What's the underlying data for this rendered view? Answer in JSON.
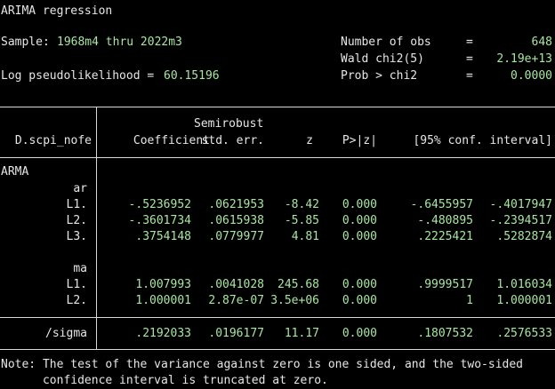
{
  "title": "ARIMA regression",
  "sample_label": "Sample:",
  "sample_value": "1968m4 thru 2022m3",
  "log_label": "Log pseudolikelihood =",
  "log_value": "60.15196",
  "stats": [
    {
      "label": "Number of obs",
      "eq": "=",
      "value": "648"
    },
    {
      "label": "Wald chi2(5)",
      "eq": "=",
      "value": "2.19e+13"
    },
    {
      "label": "Prob > chi2",
      "eq": "=",
      "value": "0.0000"
    }
  ],
  "table": {
    "depvar": "D.scpi_nofe",
    "headers": {
      "coef": "Coefficient",
      "se_top": "Semirobust",
      "se": "std. err.",
      "z": "z",
      "p": "P>|z|",
      "ci": "[95% conf. interval]"
    },
    "group_arma": "ARMA",
    "sub_ar": "ar",
    "sub_ma": "ma",
    "ar_rows": [
      {
        "label": "L1.",
        "coef": "-.5236952",
        "se": ".0621953",
        "z": "-8.42",
        "p": "0.000",
        "lo": "-.6455957",
        "hi": "-.4017947"
      },
      {
        "label": "L2.",
        "coef": "-.3601734",
        "se": ".0615938",
        "z": "-5.85",
        "p": "0.000",
        "lo": "-.480895",
        "hi": "-.2394517"
      },
      {
        "label": "L3.",
        "coef": ".3754148",
        "se": ".0779977",
        "z": "4.81",
        "p": "0.000",
        "lo": ".2225421",
        "hi": ".5282874"
      }
    ],
    "ma_rows": [
      {
        "label": "L1.",
        "coef": "1.007993",
        "se": ".0041028",
        "z": "245.68",
        "p": "0.000",
        "lo": ".9999517",
        "hi": "1.016034"
      },
      {
        "label": "L2.",
        "coef": "1.000001",
        "se": "2.87e-07",
        "z": "3.5e+06",
        "p": "0.000",
        "lo": "1",
        "hi": "1.000001"
      }
    ],
    "sigma_row": {
      "label": "/sigma",
      "coef": ".2192033",
      "se": ".0196177",
      "z": "11.17",
      "p": "0.000",
      "lo": ".1807532",
      "hi": ".2576533"
    }
  },
  "note_line1": "Note: The test of the variance against zero is one sided, and the two-sided",
  "note_line2": "      confidence interval is truncated at zero."
}
